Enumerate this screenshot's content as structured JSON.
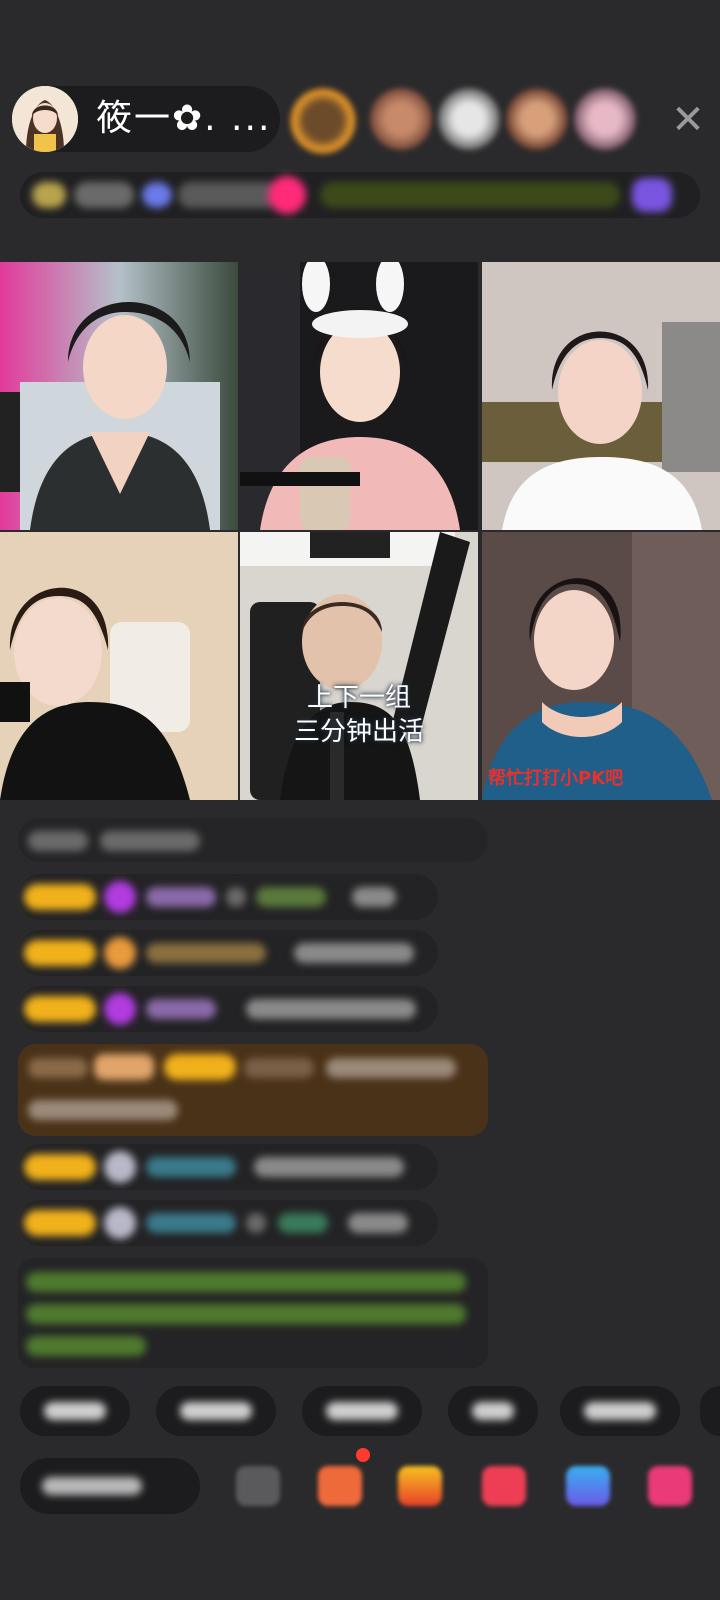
{
  "header": {
    "host_name": "筱一✿. ...",
    "close_icon": "close-icon",
    "viewer_count": 5
  },
  "grid": {
    "tiles": [
      {
        "id": 1,
        "caption": "",
        "subtitle": ""
      },
      {
        "id": 2,
        "caption": "",
        "subtitle": ""
      },
      {
        "id": 3,
        "caption": "",
        "subtitle": ""
      },
      {
        "id": 4,
        "caption": "",
        "subtitle": ""
      },
      {
        "id": 5,
        "caption_line1": "上下一组",
        "caption_line2": "三分钟出活",
        "subtitle": ""
      },
      {
        "id": 6,
        "caption": "",
        "subtitle": "帮忙打打小PK吧"
      }
    ]
  },
  "chat": {
    "messages_count": 9
  },
  "quick_replies": {
    "count": 5
  },
  "bottom_bar": {
    "tools": [
      "gift-icon",
      "box-icon",
      "lucky-icon",
      "fan-icon",
      "game-icon",
      "shop-icon"
    ]
  },
  "colors": {
    "background": "#2a2a2c",
    "badge": "#f1b11b",
    "chat_pill": "#232325"
  }
}
